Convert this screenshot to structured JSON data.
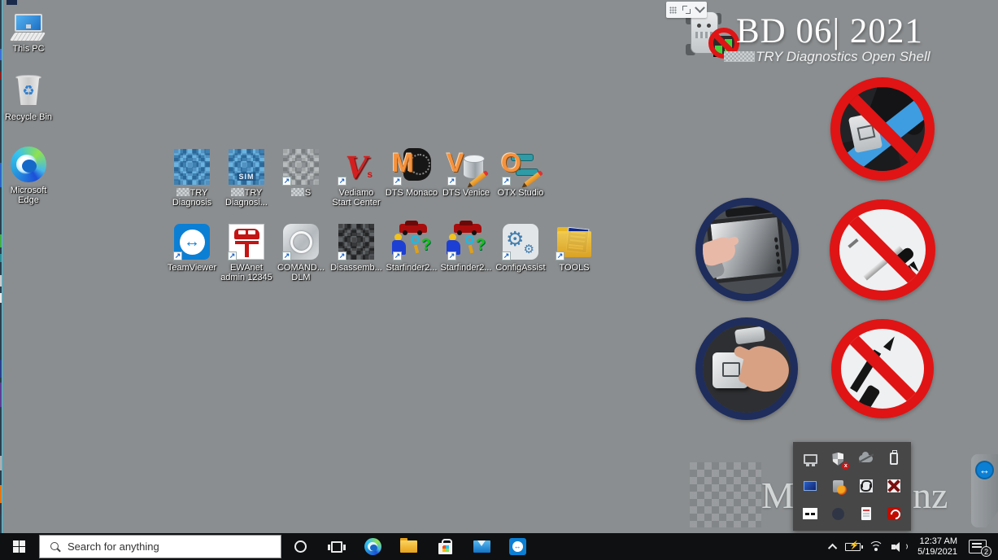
{
  "colors": {
    "desktop_bg": "#8b8e90",
    "taskbar_bg": "#0e1012",
    "prohibition_red": "#e01414",
    "navy_ring": "#1e2d5c",
    "popup_bg": "#474747",
    "accent_blue": "#0b7fd4"
  },
  "branding": {
    "title": "BD 06| 2021",
    "subtitle_suffix": "TRY Diagnostics Open Shell",
    "watermark_left_fragment": "Me",
    "watermark_right_fragment": "nz"
  },
  "desktop": {
    "left_icons": [
      {
        "id": "this-pc",
        "glyph": "this-pc",
        "shortcut": false,
        "label": {
          "lines": [
            "This PC"
          ],
          "blur_first": false
        }
      },
      {
        "id": "recycle-bin",
        "glyph": "recycle-bin",
        "shortcut": false,
        "label": {
          "lines": [
            "Recycle Bin"
          ],
          "blur_first": false
        }
      },
      {
        "id": "microsoft-edge",
        "glyph": "edge",
        "shortcut": false,
        "label": {
          "lines": [
            "Microsoft",
            "Edge"
          ],
          "blur_first": false
        }
      }
    ],
    "rows": [
      {
        "icons": [
          {
            "id": "xentry-diagnosis",
            "glyph": "mosaic-blue",
            "shortcut": false,
            "label": {
              "lines": [
                "TRY",
                "Diagnosis"
              ],
              "blur_first": true
            }
          },
          {
            "id": "xentry-diagnosis-sim",
            "glyph": "mosaic-blue",
            "badge": "SIM",
            "shortcut": false,
            "label": {
              "lines": [
                "TRY",
                "Diagnosi..."
              ],
              "blur_first": true
            }
          },
          {
            "id": "das",
            "glyph": "mosaic-gray",
            "shortcut": true,
            "label": {
              "lines": [
                "S"
              ],
              "blur_first": true
            }
          },
          {
            "id": "vediamo-start-center",
            "glyph": "vediamo",
            "logo_text": "V",
            "sub_text": "s",
            "shortcut": true,
            "label": {
              "lines": [
                "Vediamo",
                "Start Center"
              ],
              "blur_first": false
            }
          },
          {
            "id": "dts-monaco",
            "glyph": "dts-monaco",
            "logo_text": "M",
            "shortcut": true,
            "label": {
              "lines": [
                "DTS Monaco"
              ],
              "blur_first": false
            }
          },
          {
            "id": "dts-venice",
            "glyph": "dts-venice",
            "logo_text": "V",
            "shortcut": true,
            "label": {
              "lines": [
                "DTS Venice"
              ],
              "blur_first": false
            }
          },
          {
            "id": "otx-studio",
            "glyph": "otx-studio",
            "logo_text": "O",
            "shortcut": true,
            "label": {
              "lines": [
                "OTX Studio"
              ],
              "blur_first": false
            }
          }
        ]
      },
      {
        "icons": [
          {
            "id": "teamviewer",
            "glyph": "teamviewer",
            "shortcut": true,
            "label": {
              "lines": [
                "TeamViewer"
              ],
              "blur_first": false
            }
          },
          {
            "id": "ewanet-admin",
            "glyph": "ewanet",
            "shortcut": true,
            "label": {
              "lines": [
                "EWAnet",
                "admin 12345"
              ],
              "blur_first": false
            }
          },
          {
            "id": "comand-dlm",
            "glyph": "comand",
            "shortcut": true,
            "label": {
              "lines": [
                "COMAND...",
                "DLM"
              ],
              "blur_first": false
            }
          },
          {
            "id": "disassembler",
            "glyph": "mosaic-dark",
            "shortcut": true,
            "label": {
              "lines": [
                "Disassemb..."
              ],
              "blur_first": false
            }
          },
          {
            "id": "starfinder2-a",
            "glyph": "starfinder",
            "shortcut": true,
            "label": {
              "lines": [
                "Starfinder2..."
              ],
              "blur_first": false
            }
          },
          {
            "id": "starfinder2-b",
            "glyph": "starfinder",
            "shortcut": true,
            "label": {
              "lines": [
                "Starfinder2..."
              ],
              "blur_first": false
            }
          },
          {
            "id": "configassist",
            "glyph": "configassist",
            "shortcut": true,
            "label": {
              "lines": [
                "ConfigAssist"
              ],
              "blur_first": false
            }
          },
          {
            "id": "tools",
            "glyph": "tools-folder",
            "shortcut": true,
            "label": {
              "lines": [
                "TOOLS"
              ],
              "blur_first": false
            }
          }
        ]
      }
    ]
  },
  "stickers": [
    {
      "id": "no-device-sticker"
    },
    {
      "id": "tablet-touch-sticker"
    },
    {
      "id": "no-screwdriver-sticker"
    },
    {
      "id": "button-press-sticker"
    },
    {
      "id": "no-soldering-iron-sticker"
    }
  ],
  "tray_popup": {
    "icons": [
      "display-icon",
      "defender-alert-icon",
      "onedrive-offline-icon",
      "usb-device-icon",
      "remote-display-icon",
      "hdd-warning-icon",
      "serial-cable-icon",
      "network-disabled-icon",
      "minimize-strip-icon",
      "dim-app-icon",
      "document-icon",
      "acrobat-reader-icon"
    ]
  },
  "taskbar": {
    "search_placeholder": "Search for anything",
    "items": [
      {
        "id": "cortana"
      },
      {
        "id": "task-view"
      },
      {
        "id": "edge"
      },
      {
        "id": "file-explorer"
      },
      {
        "id": "store"
      },
      {
        "id": "mail"
      },
      {
        "id": "teamviewer"
      }
    ],
    "clock": {
      "time": "12:37 AM",
      "date": "5/19/2021"
    },
    "notification_count": "2"
  }
}
